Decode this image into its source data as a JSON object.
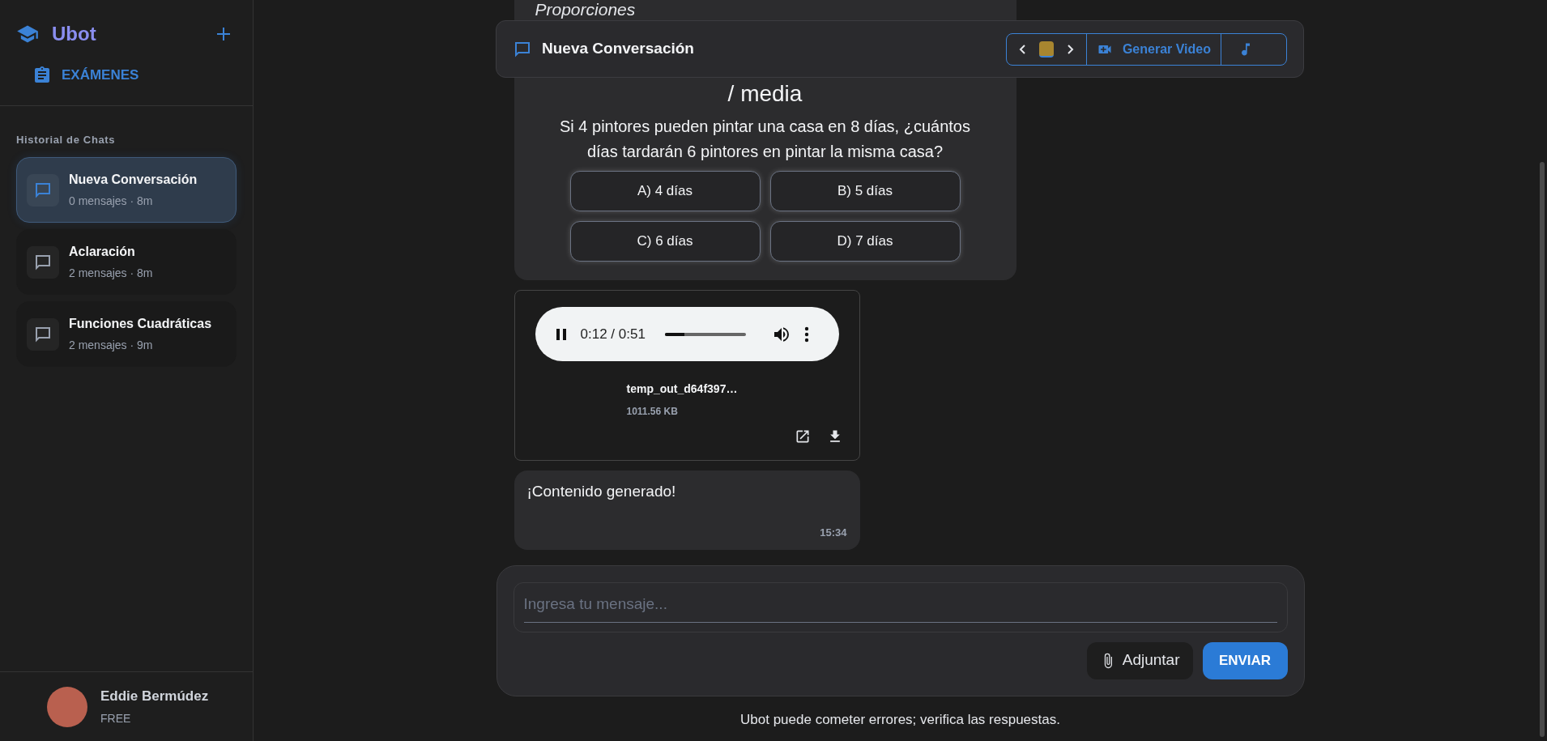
{
  "sidebar": {
    "brand": "Ubot",
    "exams_link": "EXÁMENES",
    "history_title": "Historial de Chats",
    "chats": [
      {
        "title": "Nueva Conversación",
        "meta": "0 mensajes · 8m",
        "selected": true
      },
      {
        "title": "Aclaración",
        "meta": "2 mensajes · 8m",
        "selected": false
      },
      {
        "title": "Funciones Cuadráticas",
        "meta": "2 mensajes · 9m",
        "selected": false
      }
    ],
    "user": {
      "name": "Eddie Bermúdez",
      "plan": "FREE"
    }
  },
  "header": {
    "title": "Nueva Conversación",
    "generate_video": "Generar Video"
  },
  "quiz": {
    "heading": "Proporciones",
    "subheading": "/ media",
    "question": "Si 4 pintores pueden pintar una casa en 8 días, ¿cuántos días tardarán 6 pintores en pintar la misma casa?",
    "options": [
      "A) 4 días",
      "B) 5 días",
      "C) 6 días",
      "D) 7 días"
    ]
  },
  "audio": {
    "time": "0:12 / 0:51",
    "level": 0.24,
    "file_name": "temp_out_d64f397…",
    "file_size": "1011.56 KB"
  },
  "message": {
    "text": "¡Contenido generado!",
    "time": "15:34"
  },
  "composer": {
    "placeholder": "Ingresa tu mensaje...",
    "attach": "Adjuntar",
    "send": "ENVIAR"
  },
  "disclaimer": "Ubot puede cometer errores; verifica las respuestas."
}
